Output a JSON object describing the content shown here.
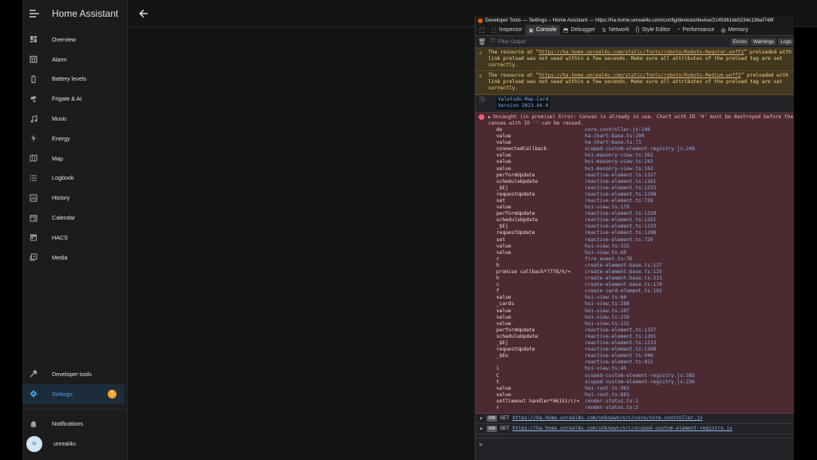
{
  "app": {
    "title": "Home Assistant"
  },
  "sidebar": {
    "items": [
      {
        "label": "Overview",
        "icon": "dashboard-icon"
      },
      {
        "label": "Alarm",
        "icon": "calendar-grid-icon"
      },
      {
        "label": "Battery levels",
        "icon": "battery-icon"
      },
      {
        "label": "Frigate & AI",
        "icon": "cctv-icon"
      },
      {
        "label": "Music",
        "icon": "music-icon"
      },
      {
        "label": "Energy",
        "icon": "lightning-icon"
      },
      {
        "label": "Map",
        "icon": "map-icon"
      },
      {
        "label": "Logbook",
        "icon": "list-icon"
      },
      {
        "label": "History",
        "icon": "chart-icon"
      },
      {
        "label": "Calendar",
        "icon": "calendar-icon"
      },
      {
        "label": "HACS",
        "icon": "hacs-icon"
      },
      {
        "label": "Media",
        "icon": "media-icon"
      }
    ],
    "developer_tools": "Developer tools",
    "settings": "Settings",
    "settings_badge": "1",
    "notifications": "Notifications",
    "user": "unreal4u",
    "user_initial": "u"
  },
  "devtools": {
    "window_title": "Developer Tools — Settings – Home Assistant — https://ha.home.unreal4u.com/config/devices/device/2145361de5234c13baf748f",
    "tabs": [
      "Inspector",
      "Console",
      "Debugger",
      "Network",
      "Style Editor",
      "Performance",
      "Memory"
    ],
    "active_tab": "Console",
    "filter_placeholder": "Filter Output",
    "filter_buttons": [
      "Errors",
      "Warnings",
      "Logs"
    ],
    "warnings": [
      {
        "pre": "The resource at “",
        "url": "https://ha.home.unreal4u.com/static/fonts/roboto/Roboto-Regular.woff2",
        "post": "” preloaded with link preload was not used within a few seconds. Make sure all attributes of the preload tag are set correctly."
      },
      {
        "pre": "The resource at “",
        "url": "https://ha.home.unreal4u.com/static/fonts/roboto/Roboto-Medium.woff2",
        "post": "” preloaded with link preload was not used within a few seconds. Make sure all attributes of the preload tag are set correctly."
      }
    ],
    "info": {
      "line1": "Valetudo-Map-Card",
      "line2": "Version 2023.04.0"
    },
    "error": {
      "message": "Uncaught (in promise) Error: Canvas is already in use. Chart with ID '0' must be destroyed before the canvas with ID '' can be reused.",
      "stack": [
        [
          "de",
          "core.controller.js:146"
        ],
        [
          "value",
          "ha-chart-base.ts:290"
        ],
        [
          "value",
          "ha-chart-base.ts:71"
        ],
        [
          "connectedCallback",
          "scoped-custom-element-registry.js:248"
        ],
        [
          "value",
          "hui-masonry-view.ts:262"
        ],
        [
          "value",
          "hui-masonry-view.ts:243"
        ],
        [
          "value",
          "hui-masonry-view.ts:163"
        ],
        [
          "performUpdate",
          "reactive-element.ts:1327"
        ],
        [
          "scheduleUpdate",
          "reactive-element.ts:1261"
        ],
        [
          "_$Ej",
          "reactive-element.ts:1233"
        ],
        [
          "requestUpdate",
          "reactive-element.ts:1208"
        ],
        [
          "set",
          "reactive-element.ts:726"
        ],
        [
          "value",
          "hui-view.ts:179"
        ],
        [
          "performUpdate",
          "reactive-element.ts:1329"
        ],
        [
          "scheduleUpdate",
          "reactive-element.ts:1261"
        ],
        [
          "_$Ej",
          "reactive-element.ts:1233"
        ],
        [
          "requestUpdate",
          "reactive-element.ts:1208"
        ],
        [
          "set",
          "reactive-element.ts:726"
        ],
        [
          "value",
          "hui-view.ts:315"
        ],
        [
          "value",
          "hui-view.ts:60"
        ],
        [
          "r",
          "fire_event.ts:76"
        ],
        [
          "h",
          "create-element-base.ts:127"
        ],
        [
          "promise callback*7778/h/<",
          "create-element-base.ts:125"
        ],
        [
          "h",
          "create-element-base.ts:213"
        ],
        [
          "c",
          "create-element-base.ts:170"
        ],
        [
          "f",
          "create-card-element.ts:102"
        ],
        [
          "value",
          "hui-view.ts:66"
        ],
        [
          "_cards",
          "hui-view.ts:288"
        ],
        [
          "value",
          "hui-view.ts:287"
        ],
        [
          "value",
          "hui-view.ts:216"
        ],
        [
          "value",
          "hui-view.ts:132"
        ],
        [
          "performUpdate",
          "reactive-element.ts:1327"
        ],
        [
          "scheduleUpdate",
          "reactive-element.ts:1261"
        ],
        [
          "_$Ej",
          "reactive-element.ts:1233"
        ],
        [
          "requestUpdate",
          "reactive-element.ts:1208"
        ],
        [
          "_$Eu",
          "reactive-element.ts:946"
        ],
        [
          "",
          "reactive-element.ts:931"
        ],
        [
          "i",
          "hui-view.ts:45"
        ],
        [
          "C",
          "scoped-custom-element-registry.js:385"
        ],
        [
          "t",
          "scoped-custom-element-registry.js:236"
        ],
        [
          "value",
          "hui-root.ts:963"
        ],
        [
          "value",
          "hui-root.ts:681"
        ],
        [
          "setTimeout handler*96151/r/<",
          "render-status.ts:2"
        ],
        [
          "r",
          "render-status.ts:2"
        ]
      ]
    },
    "network": [
      {
        "badge": "XHR",
        "method": "GET",
        "url": "https://ha.home.unreal4u.com/unknown/src/core/core.controller.js"
      },
      {
        "badge": "XHR",
        "method": "GET",
        "url": "https://ha.home.unreal4u.com/unknown/src/scoped-custom-element-registry.js"
      }
    ],
    "prompt": "»"
  }
}
